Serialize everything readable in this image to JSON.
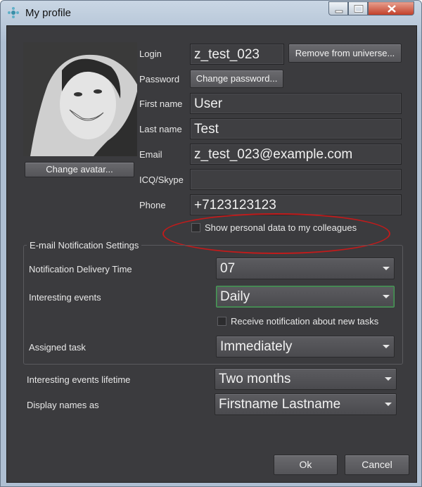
{
  "window": {
    "title": "My profile"
  },
  "avatar": {
    "change_label": "Change avatar..."
  },
  "login": {
    "label": "Login",
    "value": "z_test_023",
    "remove_label": "Remove from universe..."
  },
  "password": {
    "label": "Password",
    "change_label": "Change password..."
  },
  "first_name": {
    "label": "First name",
    "value": "User"
  },
  "last_name": {
    "label": "Last name",
    "value": "Test"
  },
  "email": {
    "label": "Email",
    "value": "z_test_023@example.com"
  },
  "icq": {
    "label": "ICQ/Skype",
    "value": ""
  },
  "phone": {
    "label": "Phone",
    "value": "+7123123123"
  },
  "show_personal": {
    "label": "Show personal data to my colleagues",
    "checked": false
  },
  "email_settings": {
    "title": "E-mail Notification Settings",
    "delivery_time": {
      "label": "Notification Delivery Time",
      "value": "07"
    },
    "interesting_events": {
      "label": "Interesting events",
      "value": "Daily"
    },
    "new_tasks": {
      "label": "Receive notification about new tasks",
      "checked": false
    },
    "assigned_task": {
      "label": "Assigned task",
      "value": "Immediately"
    }
  },
  "lifetime": {
    "label": "Interesting events lifetime",
    "value": "Two months"
  },
  "display_names": {
    "label": "Display names as",
    "value": "Firstname Lastname"
  },
  "buttons": {
    "ok": "Ok",
    "cancel": "Cancel"
  },
  "colors": {
    "background": "#3b3b3e",
    "highlight_ellipse": "#c11b1b",
    "active_combo_border": "#4f9a5e"
  }
}
